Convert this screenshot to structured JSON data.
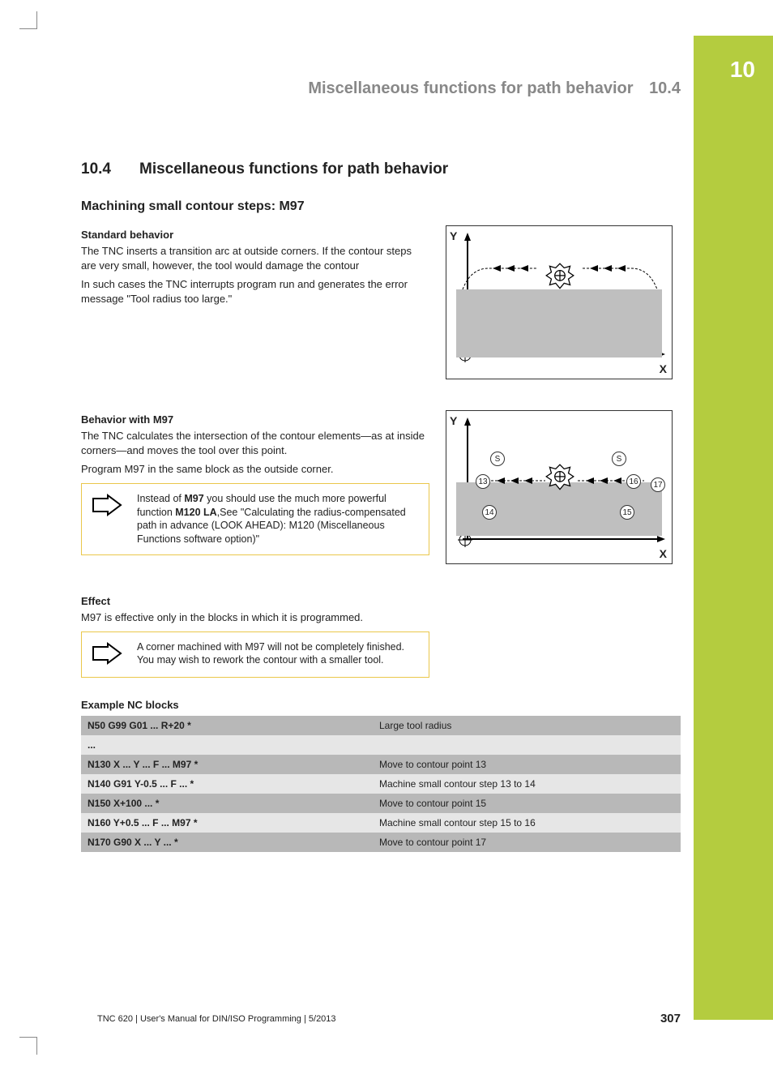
{
  "chapter_tab": "10",
  "running_head": {
    "title": "Miscellaneous functions for path behavior",
    "sec": "10.4"
  },
  "section": {
    "num": "10.4",
    "title": "Miscellaneous functions for path behavior"
  },
  "sub1": "Machining small contour steps: M97",
  "h_std": "Standard behavior",
  "p_std1": "The TNC inserts a transition arc at outside corners. If the contour steps are very small, however, the tool would damage the contour",
  "p_std2": "In such cases the TNC interrupts program run and generates the error message \"Tool radius too large.\"",
  "h_m97": "Behavior with M97",
  "p_m97a": "The TNC calculates the intersection of the contour elements—as at inside corners—and moves the tool over this point.",
  "p_m97b": "Program M97 in the same block as the outside corner.",
  "tip1_pre": "Instead of ",
  "tip1_b1": "M97",
  "tip1_mid": " you should use the much more powerful function ",
  "tip1_b2": "M120 LA",
  "tip1_post": ",See \"Calculating the radius-compensated path in advance (LOOK AHEAD): M120 (Miscellaneous Functions software option)\"",
  "h_eff": "Effect",
  "p_eff": "M97 is effective only in the blocks in which it is programmed.",
  "tip2": "A corner machined with M97 will not be completely finished. You may wish to rework the contour with a smaller tool.",
  "h_ex": "Example NC blocks",
  "rows": [
    {
      "c": "N50 G99 G01 ... R+20 *",
      "d": "Large tool radius"
    },
    {
      "c": "...",
      "d": ""
    },
    {
      "c": "N130 X ... Y ... F ... M97 *",
      "d": "Move to contour point 13"
    },
    {
      "c": "N140 G91 Y-0.5 ... F ... *",
      "d": "Machine small contour step 13 to 14"
    },
    {
      "c": "N150 X+100 ... *",
      "d": "Move to contour point 15"
    },
    {
      "c": "N160 Y+0.5 ... F ... M97 *",
      "d": "Machine small contour step 15 to 16"
    },
    {
      "c": "N170 G90 X ... Y ... *",
      "d": "Move to contour point 17"
    }
  ],
  "axis": {
    "y": "Y",
    "x": "X"
  },
  "diagram2_labels": {
    "s1": "S",
    "s2": "S",
    "n13": "13",
    "n14": "14",
    "n15": "15",
    "n16": "16",
    "n17": "17"
  },
  "footer": {
    "left": "TNC 620 | User's Manual for DIN/ISO Programming | 5/2013",
    "page": "307"
  }
}
